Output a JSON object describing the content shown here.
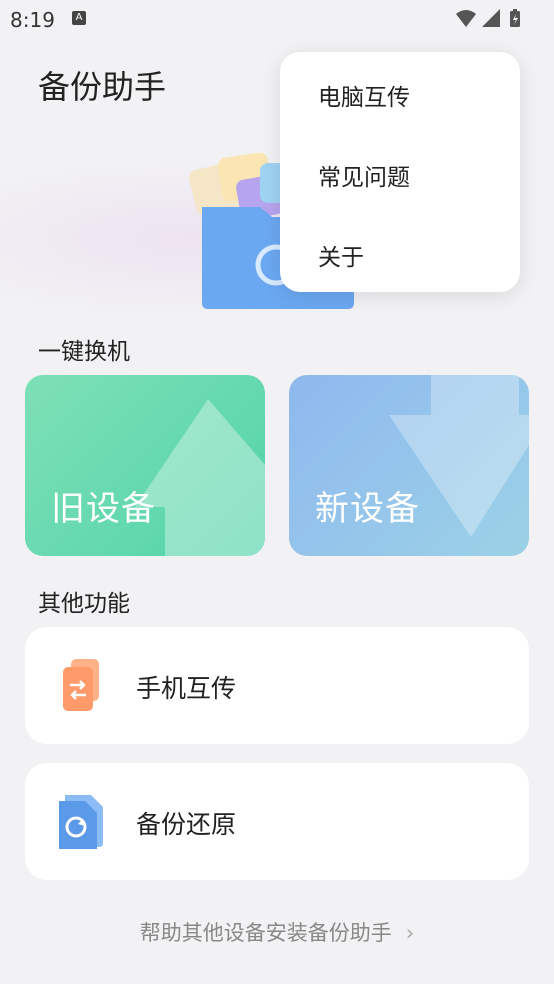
{
  "status_bar": {
    "time": "8:19",
    "notif_icon": "A"
  },
  "app": {
    "title": "备份助手"
  },
  "menu": {
    "items": [
      "电脑互传",
      "常见问题",
      "关于"
    ]
  },
  "switch_section": {
    "title": "一键换机",
    "old_device": "旧设备",
    "new_device": "新设备"
  },
  "other_section": {
    "title": "其他功能",
    "items": [
      "手机互传",
      "备份还原"
    ]
  },
  "footer": {
    "link_text": "帮助其他设备安装备份助手"
  },
  "colors": {
    "old_card": "#52d3a9",
    "new_card": "#8fb8ef",
    "background": "#f2f2f4"
  }
}
